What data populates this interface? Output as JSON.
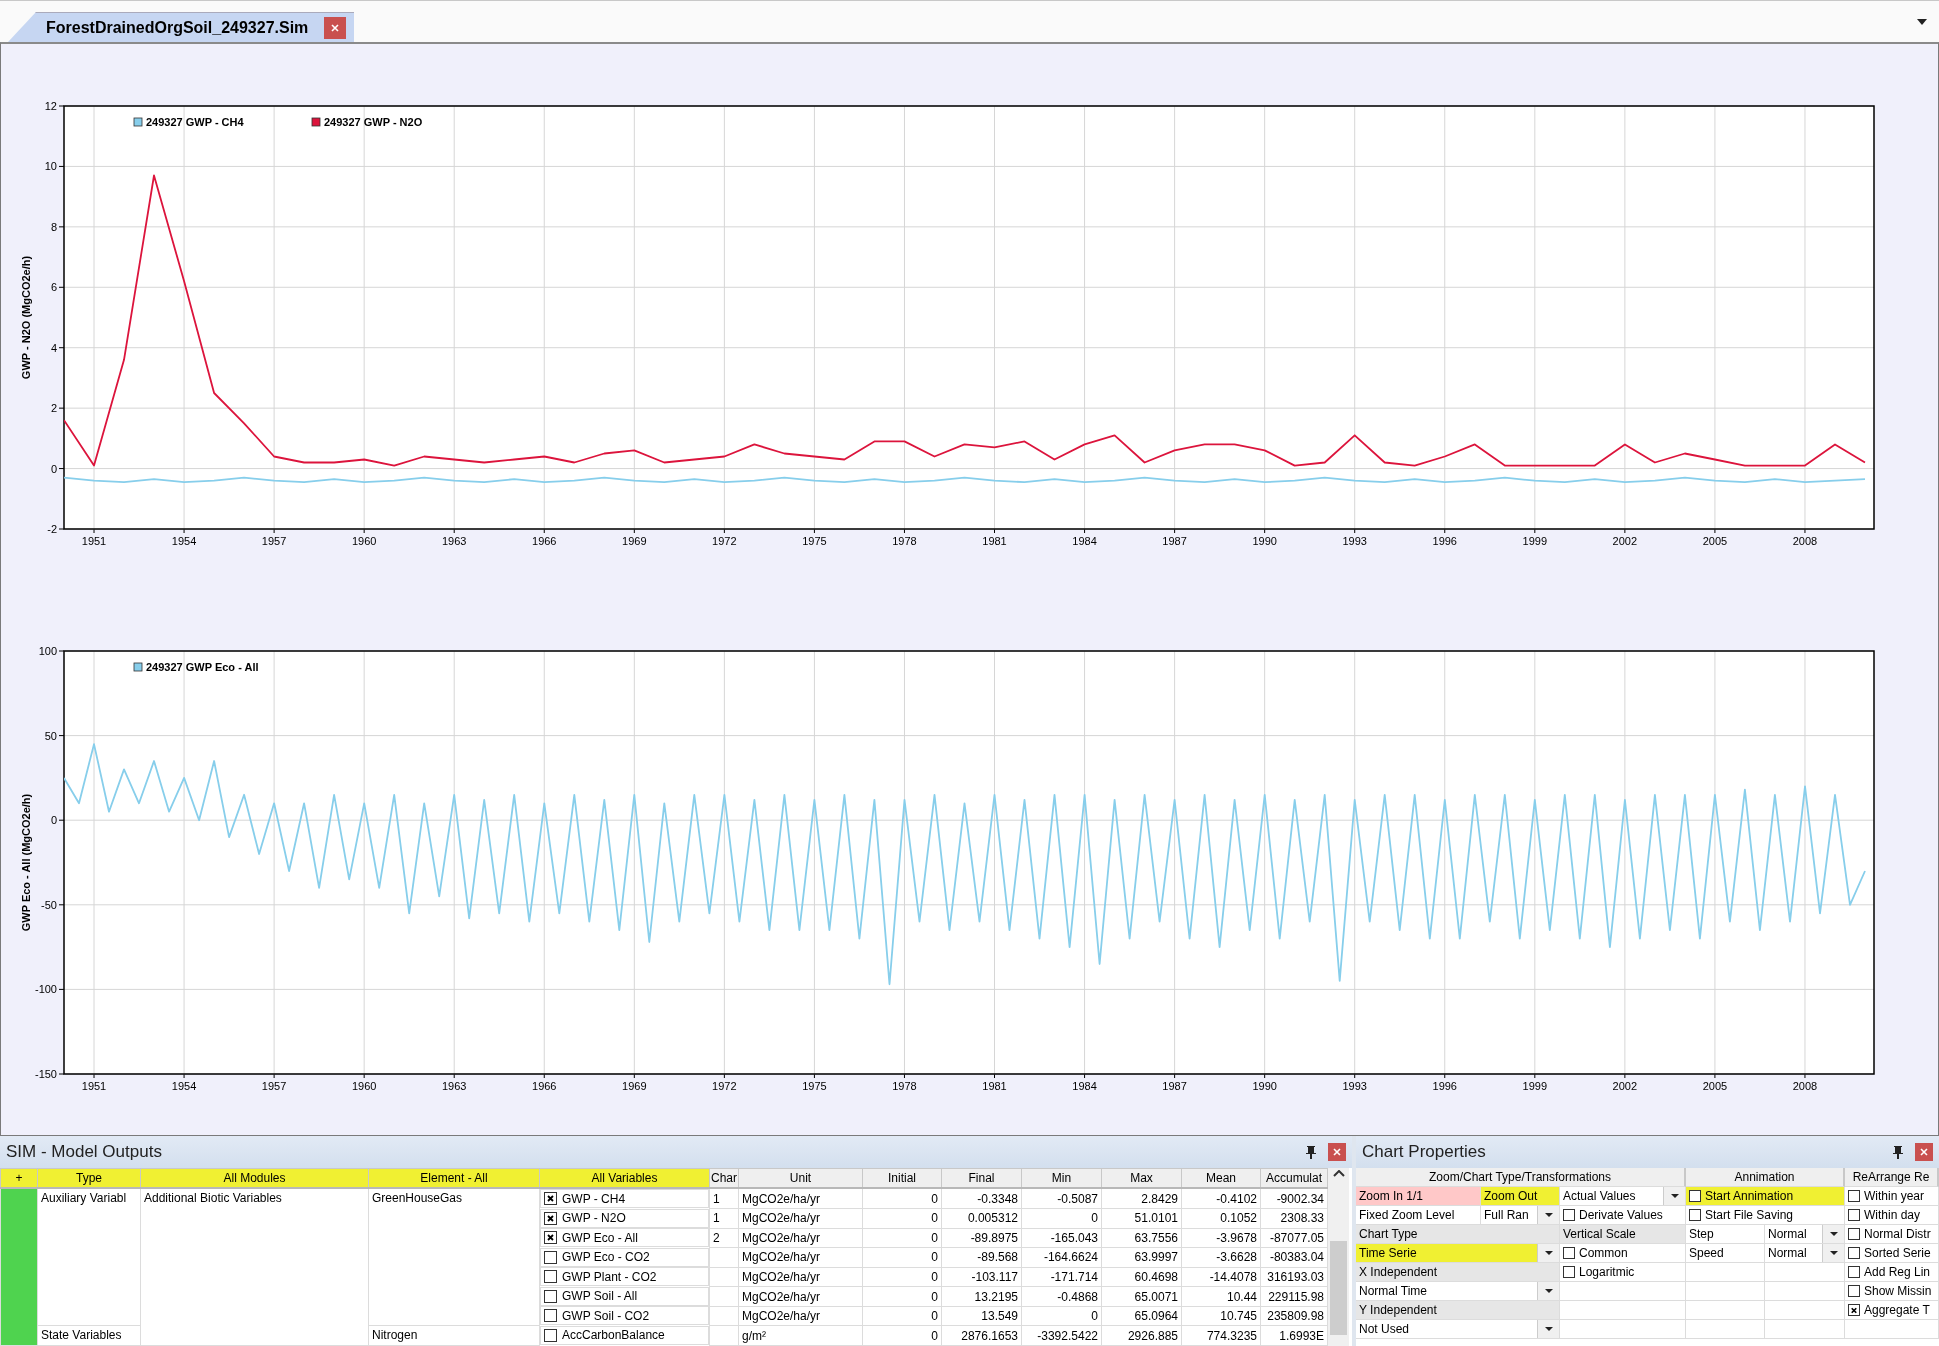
{
  "tab": {
    "title": "ForestDrainedOrgSoil_249327.Sim",
    "selected": true
  },
  "charts": [
    {
      "chart_data": {
        "type": "line",
        "ylabel": "GWP - N2O (MgCO2e/h)",
        "grid": true,
        "legend": "upper left",
        "xlim": [
          1950,
          2010.3
        ],
        "ylim": [
          -2,
          12
        ],
        "xticks": [
          1951,
          1954,
          1957,
          1960,
          1963,
          1966,
          1969,
          1972,
          1975,
          1978,
          1981,
          1984,
          1987,
          1990,
          1993,
          1996,
          1999,
          2002,
          2005,
          2008
        ],
        "yticks": [
          -2,
          0,
          2,
          4,
          6,
          8,
          10,
          12
        ],
        "x": [
          1950,
          1951,
          1952,
          1953,
          1954,
          1955,
          1956,
          1957,
          1958,
          1959,
          1960,
          1961,
          1962,
          1963,
          1964,
          1965,
          1966,
          1967,
          1968,
          1969,
          1970,
          1971,
          1972,
          1973,
          1974,
          1975,
          1976,
          1977,
          1978,
          1979,
          1980,
          1981,
          1982,
          1983,
          1984,
          1985,
          1986,
          1987,
          1988,
          1989,
          1990,
          1991,
          1992,
          1993,
          1994,
          1995,
          1996,
          1997,
          1998,
          1999,
          2000,
          2001,
          2002,
          2003,
          2004,
          2005,
          2006,
          2007,
          2008,
          2009,
          2010
        ],
        "series": [
          {
            "name": "249327 GWP - CH4",
            "color": "#87ceeb",
            "values": [
              -0.3,
              -0.4,
              -0.45,
              -0.35,
              -0.45,
              -0.4,
              -0.3,
              -0.4,
              -0.45,
              -0.35,
              -0.45,
              -0.4,
              -0.3,
              -0.4,
              -0.45,
              -0.35,
              -0.45,
              -0.4,
              -0.3,
              -0.4,
              -0.45,
              -0.35,
              -0.45,
              -0.4,
              -0.3,
              -0.4,
              -0.45,
              -0.35,
              -0.45,
              -0.4,
              -0.3,
              -0.4,
              -0.45,
              -0.35,
              -0.45,
              -0.4,
              -0.3,
              -0.4,
              -0.45,
              -0.35,
              -0.45,
              -0.4,
              -0.3,
              -0.4,
              -0.45,
              -0.35,
              -0.45,
              -0.4,
              -0.3,
              -0.4,
              -0.45,
              -0.35,
              -0.45,
              -0.4,
              -0.3,
              -0.4,
              -0.45,
              -0.35,
              -0.45,
              -0.4,
              -0.35
            ]
          },
          {
            "name": "249327 GWP - N2O",
            "color": "#dc143c",
            "values": [
              1.6,
              0.1,
              3.6,
              9.7,
              6.2,
              2.5,
              1.5,
              0.4,
              0.2,
              0.2,
              0.3,
              0.1,
              0.4,
              0.3,
              0.2,
              0.3,
              0.4,
              0.2,
              0.5,
              0.6,
              0.2,
              0.3,
              0.4,
              0.8,
              0.5,
              0.4,
              0.3,
              0.9,
              0.9,
              0.4,
              0.8,
              0.7,
              0.9,
              0.3,
              0.8,
              1.1,
              0.2,
              0.6,
              0.8,
              0.8,
              0.6,
              0.1,
              0.2,
              1.1,
              0.2,
              0.1,
              0.4,
              0.8,
              0.1,
              0.1,
              0.1,
              0.1,
              0.8,
              0.2,
              0.5,
              0.3,
              0.1,
              0.1,
              0.1,
              0.8,
              0.2
            ]
          }
        ]
      }
    },
    {
      "chart_data": {
        "type": "line",
        "ylabel": "GWP Eco - All (MgCO2e/h)",
        "grid": true,
        "legend": "upper left",
        "xlim": [
          1950,
          2010.3
        ],
        "ylim": [
          -150,
          100
        ],
        "xticks": [
          1951,
          1954,
          1957,
          1960,
          1963,
          1966,
          1969,
          1972,
          1975,
          1978,
          1981,
          1984,
          1987,
          1990,
          1993,
          1996,
          1999,
          2002,
          2005,
          2008
        ],
        "yticks": [
          -150,
          -100,
          -50,
          0,
          50,
          100
        ],
        "x": [
          1950,
          1950.5,
          1951,
          1951.5,
          1952,
          1952.5,
          1953,
          1953.5,
          1954,
          1954.5,
          1955,
          1955.5,
          1956,
          1956.5,
          1957,
          1957.5,
          1958,
          1958.5,
          1959,
          1959.5,
          1960,
          1960.5,
          1961,
          1961.5,
          1962,
          1962.5,
          1963,
          1963.5,
          1964,
          1964.5,
          1965,
          1965.5,
          1966,
          1966.5,
          1967,
          1967.5,
          1968,
          1968.5,
          1969,
          1969.5,
          1970,
          1970.5,
          1971,
          1971.5,
          1972,
          1972.5,
          1973,
          1973.5,
          1974,
          1974.5,
          1975,
          1975.5,
          1976,
          1976.5,
          1977,
          1977.5,
          1978,
          1978.5,
          1979,
          1979.5,
          1980,
          1980.5,
          1981,
          1981.5,
          1982,
          1982.5,
          1983,
          1983.5,
          1984,
          1984.5,
          1985,
          1985.5,
          1986,
          1986.5,
          1987,
          1987.5,
          1988,
          1988.5,
          1989,
          1989.5,
          1990,
          1990.5,
          1991,
          1991.5,
          1992,
          1992.5,
          1993,
          1993.5,
          1994,
          1994.5,
          1995,
          1995.5,
          1996,
          1996.5,
          1997,
          1997.5,
          1998,
          1998.5,
          1999,
          1999.5,
          2000,
          2000.5,
          2001,
          2001.5,
          2002,
          2002.5,
          2003,
          2003.5,
          2004,
          2004.5,
          2005,
          2005.5,
          2006,
          2006.5,
          2007,
          2007.5,
          2008,
          2008.5,
          2009,
          2009.5,
          2010
        ],
        "series": [
          {
            "name": "249327 GWP Eco - All",
            "color": "#87ceeb",
            "values": [
              25,
              10,
              45,
              5,
              30,
              10,
              35,
              5,
              25,
              0,
              35,
              -10,
              15,
              -20,
              10,
              -30,
              10,
              -40,
              15,
              -35,
              10,
              -40,
              15,
              -55,
              10,
              -45,
              15,
              -58,
              12,
              -55,
              15,
              -60,
              10,
              -55,
              15,
              -60,
              12,
              -65,
              15,
              -72,
              10,
              -60,
              15,
              -55,
              15,
              -60,
              12,
              -65,
              15,
              -65,
              12,
              -65,
              15,
              -70,
              12,
              -97,
              12,
              -60,
              15,
              -65,
              10,
              -60,
              15,
              -65,
              12,
              -70,
              15,
              -75,
              15,
              -85,
              12,
              -70,
              15,
              -60,
              12,
              -70,
              15,
              -75,
              12,
              -65,
              15,
              -70,
              12,
              -60,
              15,
              -95,
              12,
              -60,
              15,
              -65,
              15,
              -70,
              12,
              -70,
              15,
              -60,
              15,
              -70,
              12,
              -65,
              15,
              -70,
              15,
              -75,
              12,
              -70,
              15,
              -65,
              15,
              -70,
              15,
              -60,
              18,
              -65,
              15,
              -60,
              20,
              -55,
              15,
              -50,
              -30
            ]
          }
        ]
      }
    }
  ],
  "outputs_panel": {
    "title": "SIM - Model Outputs",
    "columns": [
      {
        "label": "+",
        "kind": "filter"
      },
      {
        "label": "Type",
        "kind": "filter"
      },
      {
        "label": "All Modules",
        "kind": "filter"
      },
      {
        "label": "Element - All",
        "kind": "filter"
      },
      {
        "label": "All Variables",
        "kind": "filter"
      },
      {
        "label": "Char",
        "kind": "plain"
      },
      {
        "label": "Unit",
        "kind": "plain"
      },
      {
        "label": "Initial",
        "kind": "plain"
      },
      {
        "label": "Final",
        "kind": "plain"
      },
      {
        "label": "Min",
        "kind": "plain"
      },
      {
        "label": "Max",
        "kind": "plain"
      },
      {
        "label": "Mean",
        "kind": "plain"
      },
      {
        "label": "Accumulat",
        "kind": "plain"
      }
    ],
    "rows": [
      {
        "type": "Auxiliary Variabl",
        "module": "Additional Biotic Variables",
        "element": "GreenHouseGas",
        "variable": "GWP - CH4",
        "checked": true,
        "chart": "1",
        "unit": "MgCO2e/ha/yr",
        "initial": "0",
        "final": "-0.3348",
        "min": "-0.5087",
        "max": "2.8429",
        "mean": "-0.4102",
        "accumulated": "-9002.34"
      },
      {
        "variable": "GWP - N2O",
        "checked": true,
        "chart": "1",
        "unit": "MgCO2e/ha/yr",
        "initial": "0",
        "final": "0.005312",
        "min": "0",
        "max": "51.0101",
        "mean": "0.1052",
        "accumulated": "2308.33"
      },
      {
        "variable": "GWP Eco - All",
        "checked": true,
        "chart": "2",
        "unit": "MgCO2e/ha/yr",
        "initial": "0",
        "final": "-89.8975",
        "min": "-165.043",
        "max": "63.7556",
        "mean": "-3.9678",
        "accumulated": "-87077.05"
      },
      {
        "variable": "GWP Eco - CO2",
        "checked": false,
        "unit": "MgCO2e/ha/yr",
        "initial": "0",
        "final": "-89.568",
        "min": "-164.6624",
        "max": "63.9997",
        "mean": "-3.6628",
        "accumulated": "-80383.04"
      },
      {
        "variable": "GWP Plant - CO2",
        "checked": false,
        "unit": "MgCO2e/ha/yr",
        "initial": "0",
        "final": "-103.117",
        "min": "-171.714",
        "max": "60.4698",
        "mean": "-14.4078",
        "accumulated": "316193.03"
      },
      {
        "variable": "GWP Soil  - All",
        "checked": false,
        "unit": "MgCO2e/ha/yr",
        "initial": "0",
        "final": "13.2195",
        "min": "-0.4868",
        "max": "65.0071",
        "mean": "10.44",
        "accumulated": "229115.98"
      },
      {
        "variable": "GWP Soil - CO2",
        "checked": false,
        "unit": "MgCO2e/ha/yr",
        "initial": "0",
        "final": "13.549",
        "min": "0",
        "max": "65.0964",
        "mean": "10.745",
        "accumulated": "235809.98"
      },
      {
        "type": "State Variables",
        "element": "Nitrogen",
        "variable": "AccCarbonBalance",
        "checked": false,
        "unit": "g/m²",
        "initial": "0",
        "final": "2876.1653",
        "min": "-3392.5422",
        "max": "2926.885",
        "mean": "774.3235",
        "accumulated": "1.6993E"
      }
    ]
  },
  "properties_panel": {
    "title": "Chart Properties",
    "column_groups": [
      "Zoom/Chart Type/Transformations",
      "Annimation",
      "ReArrange Re"
    ],
    "rows": [
      [
        {
          "kind": "button",
          "text": "Zoom In 1/1",
          "color": "#ffc8c8"
        },
        {
          "kind": "button",
          "text": "Zoom Out",
          "color": "#f0f032"
        },
        {
          "kind": "dropdown",
          "text": "Actual Values"
        },
        {
          "kind": "checkbox",
          "text": "Start Annimation",
          "checked": false,
          "color": "#f0f032"
        },
        {
          "kind": "checkbox",
          "text": "Within year",
          "checked": false
        }
      ],
      [
        {
          "kind": "label",
          "text": "Fixed Zoom Level"
        },
        {
          "kind": "dropdown",
          "text": "Full Ran"
        },
        {
          "kind": "checkbox",
          "text": "Derivate Values",
          "checked": false
        },
        {
          "kind": "checkbox",
          "text": "Start File Saving",
          "checked": false
        },
        {
          "kind": "checkbox",
          "text": "Within day",
          "checked": false
        }
      ],
      [
        {
          "kind": "section",
          "text": "Chart Type"
        },
        {
          "kind": "section",
          "text": "Vertical Scale"
        },
        {
          "kind": "label",
          "text": "Step"
        },
        {
          "kind": "dropdown",
          "text": "Normal"
        },
        {
          "kind": "checkbox",
          "text": "Normal Distr",
          "checked": false
        }
      ],
      [
        {
          "kind": "dropdown",
          "text": "Time Serie",
          "color": "#f0f032"
        },
        {
          "kind": "checkbox",
          "text": "Common",
          "checked": false
        },
        {
          "kind": "label",
          "text": "Speed"
        },
        {
          "kind": "dropdown",
          "text": "Normal"
        },
        {
          "kind": "checkbox",
          "text": "Sorted Serie",
          "checked": false
        }
      ],
      [
        {
          "kind": "section",
          "text": "X Independent"
        },
        {
          "kind": "checkbox",
          "text": "Logaritmic",
          "checked": false
        },
        "",
        "",
        {
          "kind": "checkbox",
          "text": "Add Reg Lin",
          "checked": false
        }
      ],
      [
        {
          "kind": "dropdown",
          "text": "Normal Time"
        },
        "",
        "",
        "",
        {
          "kind": "checkbox",
          "text": "Show Missin",
          "checked": false
        }
      ],
      [
        {
          "kind": "section",
          "text": "Y Independent"
        },
        "",
        "",
        "",
        {
          "kind": "checkbox",
          "text": "Aggregate T",
          "checked": true
        }
      ],
      [
        {
          "kind": "dropdown",
          "text": "Not Used"
        },
        "",
        "",
        "",
        ""
      ]
    ]
  }
}
